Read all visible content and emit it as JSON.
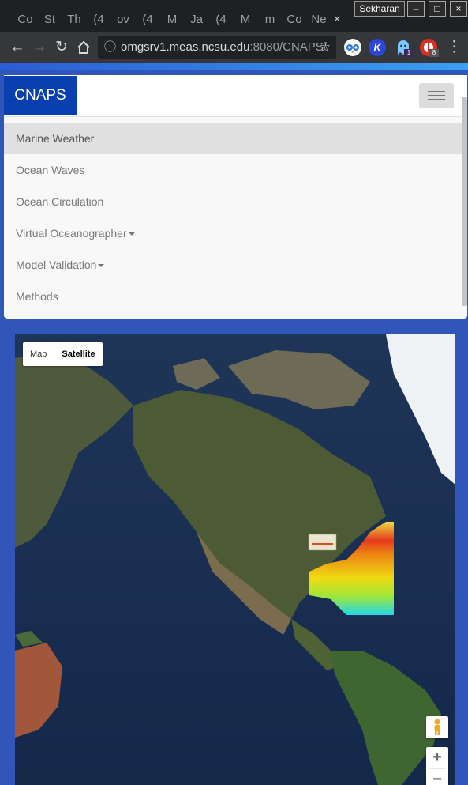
{
  "browser": {
    "tabs": [
      "Co",
      "St",
      "Th",
      "(4",
      "ov",
      "(4",
      "M",
      "Ja",
      "(4",
      "M",
      "m",
      "Co",
      "Ne"
    ],
    "active_tab_close": "×",
    "profile_name": "Sekharan",
    "window_buttons": [
      "–",
      "□",
      "×"
    ],
    "url_host": "omgsrv1.meas.ncsu.edu",
    "url_path": ":8080/CNAPS/",
    "extensions": [
      {
        "icon": "owl-extension-icon",
        "color": "#ffffff",
        "badge": ""
      },
      {
        "icon": "k-extension-icon",
        "color": "#2b47d9",
        "badge": ""
      },
      {
        "icon": "ghost-extension-icon",
        "color": "#7fc6ff",
        "badge": "1"
      },
      {
        "icon": "shield-extension-icon",
        "color": "#d93025",
        "badge": "8"
      }
    ]
  },
  "navbar": {
    "brand": "CNAPS",
    "menu": [
      {
        "label": "Marine Weather",
        "active": true,
        "dropdown": false
      },
      {
        "label": "Ocean Waves",
        "active": false,
        "dropdown": false
      },
      {
        "label": "Ocean Circulation",
        "active": false,
        "dropdown": false
      },
      {
        "label": "Virtual Oceanographer",
        "active": false,
        "dropdown": true
      },
      {
        "label": "Model Validation",
        "active": false,
        "dropdown": true
      },
      {
        "label": "Methods",
        "active": false,
        "dropdown": false
      }
    ]
  },
  "map": {
    "type_buttons": [
      "Map",
      "Satellite"
    ],
    "selected_type": "Satellite",
    "zoom_in": "+",
    "zoom_out": "−"
  },
  "colors": {
    "brand_bg": "#0a3fb0",
    "page_bg": "#2f56b8"
  }
}
